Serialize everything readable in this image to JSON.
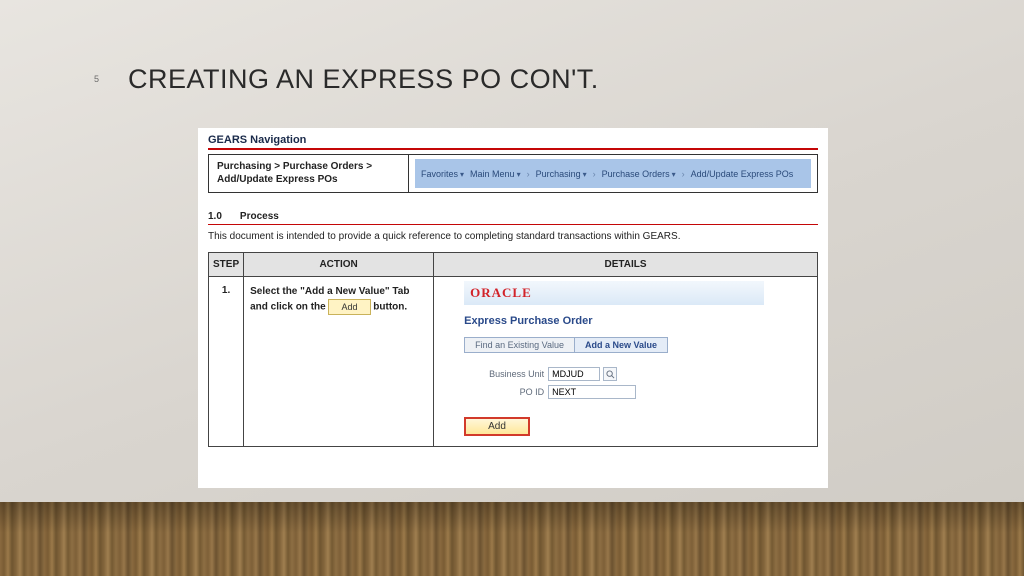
{
  "slide_number": "5",
  "title": "CREATING AN EXPRESS PO CON'T.",
  "gears_heading": "GEARS Navigation",
  "nav_path": "Purchasing > Purchase Orders > Add/Update Express POs",
  "breadcrumbs": {
    "favorites": "Favorites",
    "main_menu": "Main Menu",
    "purchasing": "Purchasing",
    "purchase_orders": "Purchase Orders",
    "add_update": "Add/Update Express POs"
  },
  "section_num": "1.0",
  "section_title": "Process",
  "intro": "This document is intended to provide a quick reference to completing standard transactions within GEARS.",
  "table": {
    "head_step": "STEP",
    "head_action": "ACTION",
    "head_details": "DETAILS"
  },
  "row1": {
    "step": "1.",
    "action_a": "Select the \"Add a New Value\" Tab and click on the ",
    "action_chip": "Add",
    "action_b": " button."
  },
  "oracle": {
    "logo": "ORACLE",
    "subhead": "Express Purchase Order",
    "tab_find": "Find an Existing Value",
    "tab_add": "Add a New Value",
    "bu_label": "Business Unit",
    "bu_value": "MDJUD",
    "poid_label": "PO ID",
    "poid_value": "NEXT",
    "add_btn": "Add"
  }
}
